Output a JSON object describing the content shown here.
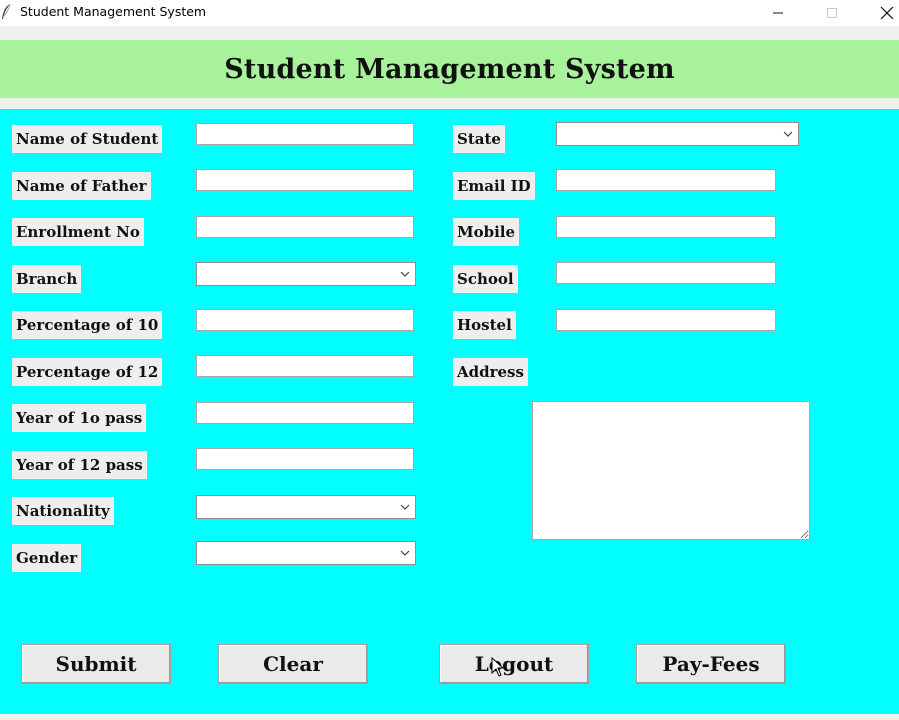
{
  "window": {
    "title": "Student Management System"
  },
  "header": {
    "heading": "Student Management System",
    "color": "#a7f29b"
  },
  "form": {
    "background": "#00ffff",
    "left": [
      {
        "label": "Name of Student",
        "type": "entry",
        "value": ""
      },
      {
        "label": "Name of Father",
        "type": "entry",
        "value": ""
      },
      {
        "label": "Enrollment No",
        "type": "entry",
        "value": ""
      },
      {
        "label": "Branch",
        "type": "combobox",
        "value": ""
      },
      {
        "label": "Percentage of 10",
        "type": "entry",
        "value": ""
      },
      {
        "label": "Percentage of 12",
        "type": "entry",
        "value": ""
      },
      {
        "label": "Year of 1o pass",
        "type": "entry",
        "value": ""
      },
      {
        "label": "Year of 12 pass",
        "type": "entry",
        "value": ""
      },
      {
        "label": "Nationality",
        "type": "combobox",
        "value": ""
      },
      {
        "label": "Gender",
        "type": "combobox",
        "value": ""
      }
    ],
    "right": [
      {
        "label": "State",
        "type": "combobox",
        "value": ""
      },
      {
        "label": "Email ID",
        "type": "entry",
        "value": ""
      },
      {
        "label": "Mobile",
        "type": "entry",
        "value": ""
      },
      {
        "label": "School",
        "type": "entry",
        "value": ""
      },
      {
        "label": "Hostel",
        "type": "entry",
        "value": ""
      },
      {
        "label": "Address",
        "type": "textarea",
        "value": ""
      }
    ]
  },
  "buttons": {
    "submit": "Submit",
    "clear": "Clear",
    "logout": "Logout",
    "pay_fees": "Pay-Fees"
  },
  "icons": {
    "app": "feather-icon",
    "minimize": "minimize-icon",
    "maximize": "maximize-icon",
    "close": "close-icon",
    "dropdown": "chevron-down-icon",
    "cursor": "mouse-pointer-icon"
  }
}
